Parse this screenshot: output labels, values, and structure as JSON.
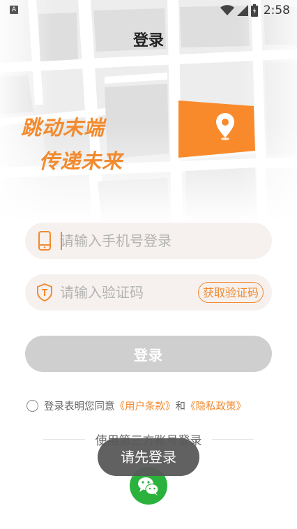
{
  "status_bar": {
    "app_icon_letter": "A",
    "time": "2:58"
  },
  "header": {
    "title": "登录"
  },
  "hero": {
    "slogan_line1": "跳动末端",
    "slogan_line2": "传递未来"
  },
  "form": {
    "phone_placeholder": "请输入手机号登录",
    "code_placeholder": "请输入验证码",
    "get_code_label": "获取验证码",
    "login_label": "登录"
  },
  "agreement": {
    "prefix": "登录表明您同意",
    "user_terms": "《用户条款》",
    "and": "和",
    "privacy_policy": "《隐私政策》"
  },
  "third_party": {
    "label": "使用第三方账号登录",
    "wechat_icon": "wechat-icon"
  },
  "toast": {
    "text": "请先登录"
  },
  "colors": {
    "accent": "#f28a2e",
    "field_bg": "#f6f1ee",
    "disabled_button": "#cfcfcf",
    "wechat_green": "#2ab23c"
  }
}
